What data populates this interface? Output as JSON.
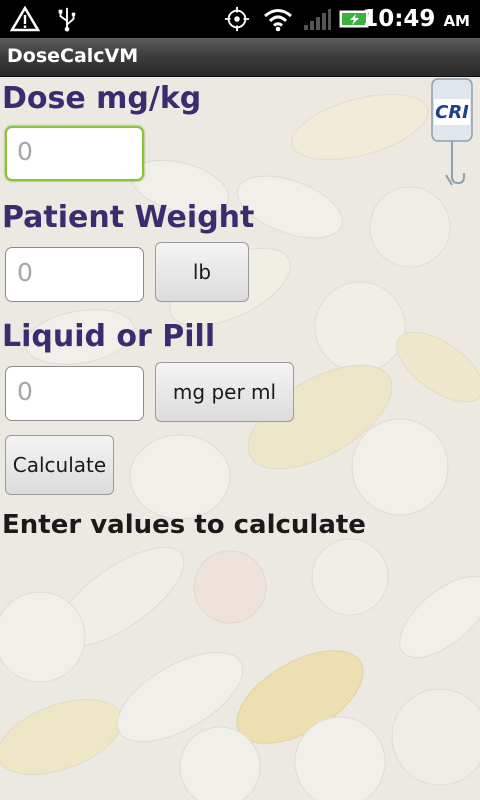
{
  "status_bar": {
    "time": "10:49",
    "ampm": "AM",
    "icons": [
      "alert-icon",
      "usb-icon",
      "gps-icon",
      "wifi-icon",
      "signal-icon",
      "battery-icon"
    ]
  },
  "app": {
    "title": "DoseCalcVM"
  },
  "form": {
    "dose_label": "Dose mg/kg",
    "dose_placeholder": "0",
    "weight_label": "Patient Weight",
    "weight_placeholder": "0",
    "weight_unit": "lb",
    "liquid_label": "Liquid or Pill",
    "liquid_placeholder": "0",
    "liquid_unit": "mg per ml",
    "calculate_label": "Calculate",
    "result_text": "Enter values to calculate"
  },
  "cri_button": {
    "label": "CRI"
  },
  "colors": {
    "label": "#3a2c6e",
    "focus": "#8ac43f"
  }
}
